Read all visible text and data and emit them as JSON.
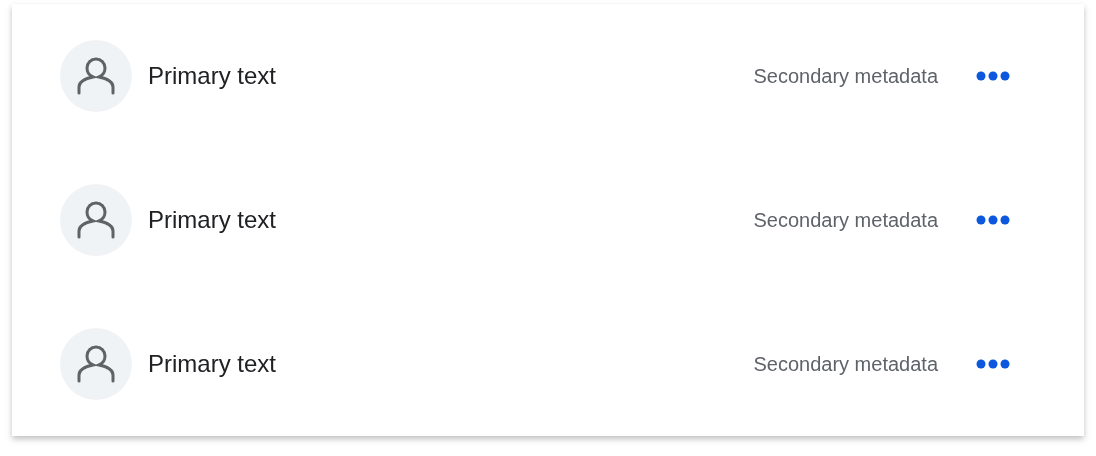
{
  "list": [
    {
      "primary": "Primary text",
      "secondary": "Secondary metadata"
    },
    {
      "primary": "Primary text",
      "secondary": "Secondary metadata"
    },
    {
      "primary": "Primary text",
      "secondary": "Secondary metadata"
    }
  ]
}
